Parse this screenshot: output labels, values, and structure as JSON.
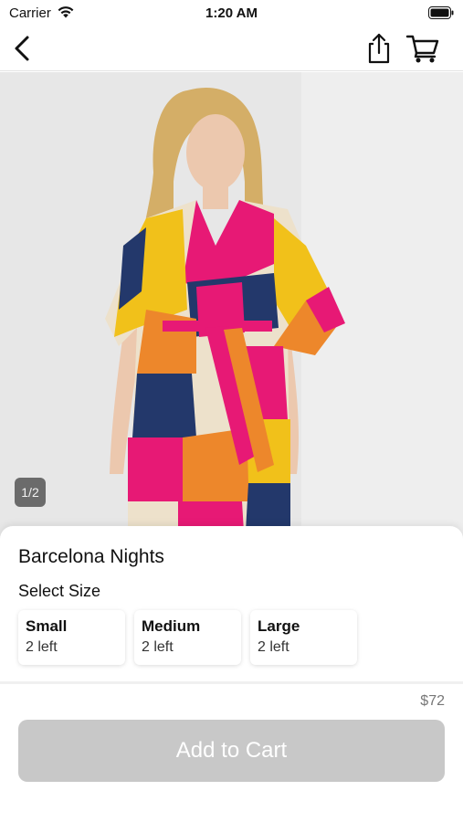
{
  "status_bar": {
    "carrier": "Carrier",
    "time": "1:20 AM"
  },
  "nav": {
    "back_icon": "chevron-left-icon",
    "share_icon": "share-icon",
    "cart_icon": "cart-icon"
  },
  "product": {
    "image_description_icon": "product-photo",
    "page_indicator": "1/2",
    "name": "Barcelona Nights",
    "select_size_label": "Select Size",
    "sizes": [
      {
        "name": "Small",
        "stock": "2 left"
      },
      {
        "name": "Medium",
        "stock": "2 left"
      },
      {
        "name": "Large",
        "stock": "2 left"
      }
    ],
    "price": "$72",
    "add_to_cart_label": "Add to Cart"
  },
  "colors": {
    "button_disabled": "#c8c8c8",
    "background": "#ffffff",
    "image_background": "#eeeeee"
  }
}
